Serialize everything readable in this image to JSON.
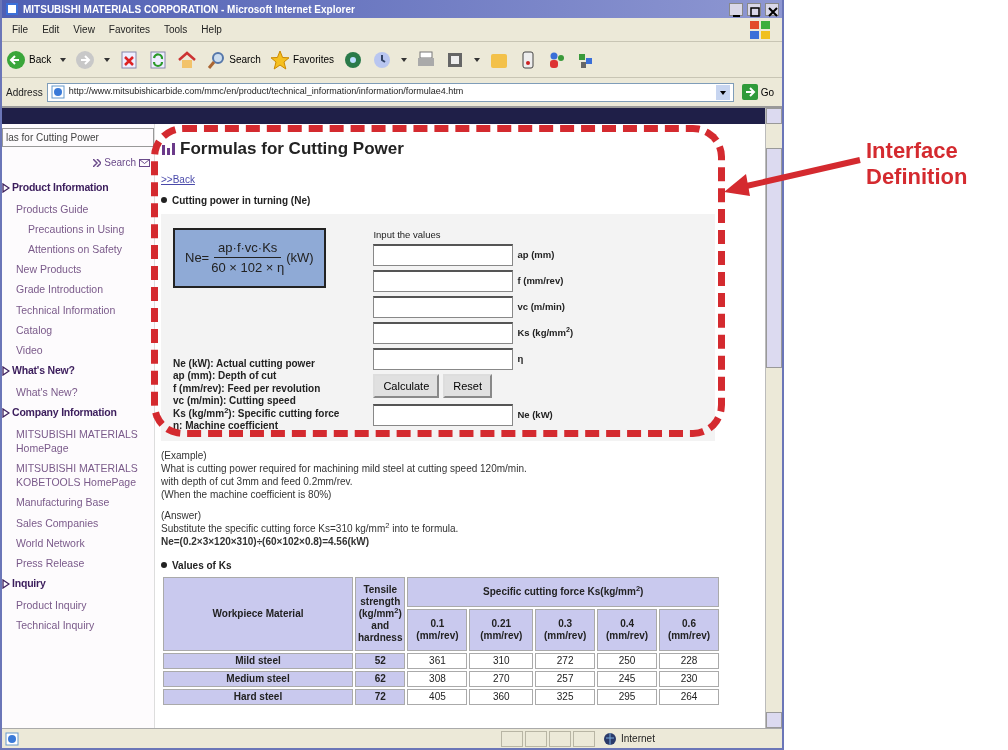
{
  "window": {
    "title": "MITSUBISHI MATERIALS CORPORATION - Microsoft Internet Explorer"
  },
  "menu": [
    "File",
    "Edit",
    "View",
    "Favorites",
    "Tools",
    "Help"
  ],
  "toolbar": [
    {
      "kind": "back",
      "label": "Back",
      "dropdown": true
    },
    {
      "kind": "forward",
      "dropdown": true
    },
    {
      "kind": "stop",
      "dropdown": false
    },
    {
      "kind": "refresh",
      "dropdown": false
    },
    {
      "kind": "home",
      "dropdown": false
    },
    {
      "kind": "search",
      "label": "Search",
      "dropdown": false
    },
    {
      "kind": "favorites",
      "label": "Favorites",
      "dropdown": false
    },
    {
      "kind": "media",
      "dropdown": false
    },
    {
      "kind": "history",
      "dropdown": true
    },
    {
      "kind": "print",
      "dropdown": false
    },
    {
      "kind": "edit",
      "dropdown": true
    },
    {
      "kind": "folder",
      "dropdown": false
    },
    {
      "kind": "phone",
      "dropdown": false
    },
    {
      "kind": "people",
      "dropdown": false
    },
    {
      "kind": "puzzle",
      "dropdown": false
    }
  ],
  "address": {
    "label": "Address",
    "value": "http://www.mitsubishicarbide.com/mmc/en/product/technical_information/information/formulae4.htm",
    "go": "Go"
  },
  "sidebar": {
    "title": "las for Cutting Power",
    "search": "Search",
    "sections": [
      {
        "label": "Product Information",
        "items": [
          {
            "label": "Products Guide",
            "children": [
              {
                "label": "Precautions in Using"
              },
              {
                "label": "Attentions on Safety"
              }
            ]
          },
          {
            "label": "New Products"
          },
          {
            "label": "Grade Introduction"
          },
          {
            "label": "Technical Information"
          },
          {
            "label": "Catalog"
          },
          {
            "label": "Video"
          }
        ]
      },
      {
        "label": "What's New?",
        "items": [
          {
            "label": "What's New?"
          }
        ]
      },
      {
        "label": "Company Information",
        "items": [
          {
            "label": "MITSUBISHI MATERIALS HomePage"
          },
          {
            "label": "MITSUBISHI MATERIALS KOBETOOLS HomePage"
          },
          {
            "label": "Manufacturing Base"
          },
          {
            "label": "Sales Companies"
          },
          {
            "label": "World Network"
          },
          {
            "label": "Press Release"
          }
        ]
      },
      {
        "label": "Inquiry",
        "items": [
          {
            "label": "Product Inquiry"
          },
          {
            "label": "Technical Inquiry"
          }
        ]
      }
    ]
  },
  "page": {
    "title": "Formulas for Cutting Power",
    "back": ">>Back",
    "section": "Cutting power in turning (Ne)",
    "formula": {
      "lhs": "Ne=",
      "numerator": "ap·f·vc·Ks",
      "denominator": "60 × 102 × η",
      "unit": "(kW)"
    },
    "definitions": [
      "Ne (kW): Actual cutting power",
      "ap (mm): Depth of cut",
      "f (mm/rev): Feed per revolution",
      "vc (m/min): Cutting speed",
      "Ks (kg/mm$^{2}$): Specific cutting force",
      "η: Machine coefficient"
    ],
    "form": {
      "heading": "Input the values",
      "inputs": [
        "ap (mm)",
        "f (mm/rev)",
        "vc (m/min)",
        "Ks (kg/mm$^{2}$)",
        "η"
      ],
      "buttons": [
        "Calculate",
        "Reset"
      ],
      "result": "Ne (kW)"
    },
    "example": {
      "heading": "(Example)",
      "lines": [
        "What is cutting power required for machining mild steel at cutting speed 120m/min.",
        "with depth of cut 3mm and feed 0.2mm/rev.",
        "(When the machine coefficient is 80%)"
      ]
    },
    "answer": {
      "heading": "(Answer)",
      "text": "Substitute the specific cutting force Ks=310 kg/mm$^{2}$ into te formula.",
      "result": "Ne=(0.2×3×120×310)÷(60×102×0.8)=4.56(kW)"
    },
    "table": {
      "title": "Values of Ks",
      "columns": [
        "Workpiece Material",
        "Tensile strength (kg/mm$^{2}$) and hardness",
        "Specific cutting force Ks(kg/mm$^{2}$)"
      ],
      "feeds": [
        "0.1 (mm/rev)",
        "0.21 (mm/rev)",
        "0.3 (mm/rev)",
        "0.4 (mm/rev)",
        "0.6 (mm/rev)"
      ],
      "rows": [
        {
          "material": "Mild steel",
          "strength": "52",
          "values": [
            "361",
            "310",
            "272",
            "250",
            "228"
          ]
        },
        {
          "material": "Medium steel",
          "strength": "62",
          "values": [
            "308",
            "270",
            "257",
            "245",
            "230"
          ]
        },
        {
          "material": "Hard steel",
          "strength": "72",
          "values": [
            "405",
            "360",
            "325",
            "295",
            "264"
          ]
        }
      ]
    }
  },
  "status_bar": {
    "zone": "Internet"
  },
  "annotation": {
    "label": "Interface Definition"
  }
}
